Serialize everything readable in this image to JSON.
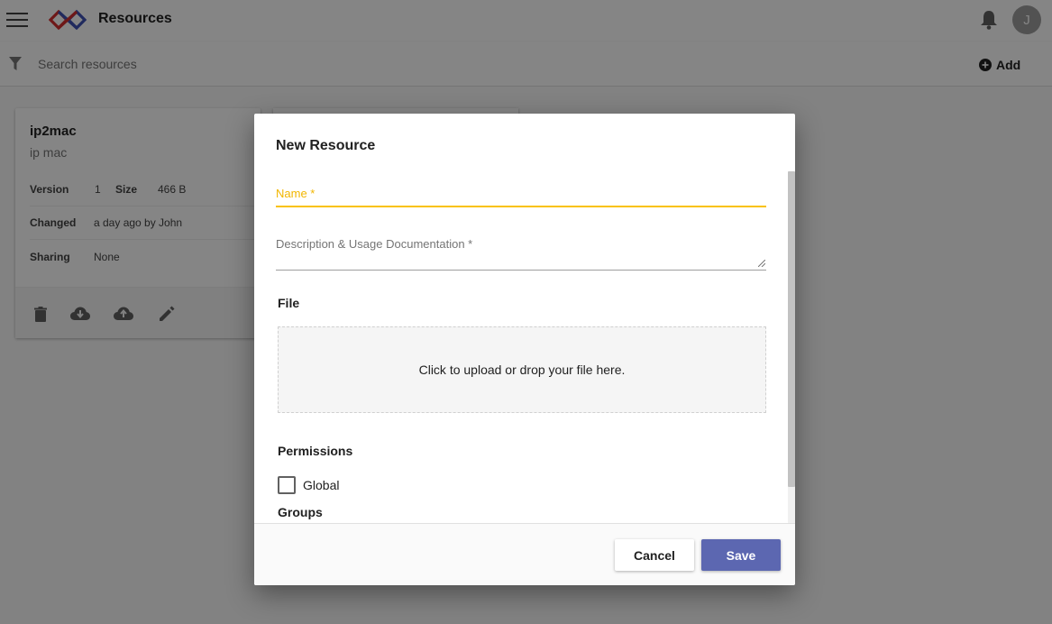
{
  "app": {
    "title": "Resources",
    "user_initial": "J"
  },
  "search": {
    "placeholder": "Search resources",
    "value": ""
  },
  "toolbar": {
    "add_label": "Add"
  },
  "resource_card": {
    "name": "ip2mac",
    "description": "ip mac",
    "version_label": "Version",
    "version_value": "1",
    "size_label": "Size",
    "size_value": "466 B",
    "changed_label": "Changed",
    "changed_value": "a day ago by John",
    "sharing_label": "Sharing",
    "sharing_value": "None",
    "actions": [
      "delete-icon",
      "cloud-download-icon",
      "cloud-upload-icon",
      "edit-icon"
    ]
  },
  "dialog": {
    "title": "New Resource",
    "name_label": "Name *",
    "name_value": "",
    "description_label": "Description & Usage Documentation *",
    "description_value": "",
    "file_label": "File",
    "dropzone_text": "Click to upload or drop your file here.",
    "permissions_label": "Permissions",
    "global_label": "Global",
    "global_checked": false,
    "groups_label": "Groups",
    "cancel_label": "Cancel",
    "save_label": "Save"
  },
  "colors": {
    "accent_yellow": "#f2b600",
    "primary": "#5c67b1",
    "logo_red": "#d32f2f",
    "logo_blue": "#3f51b5"
  }
}
